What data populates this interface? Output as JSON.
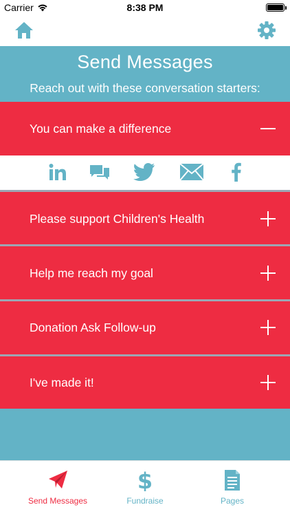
{
  "status_bar": {
    "carrier": "Carrier",
    "time": "8:38 PM"
  },
  "nav": {
    "home_icon": "home-icon",
    "settings_icon": "gear-icon"
  },
  "header": {
    "title": "Send Messages",
    "subtitle": "Reach out with these conversation starters:"
  },
  "sections": [
    {
      "label": "You can make a difference",
      "expanded": true
    },
    {
      "label": "Please support Children's Health",
      "expanded": false
    },
    {
      "label": "Help me reach my goal",
      "expanded": false
    },
    {
      "label": "Donation Ask Follow-up",
      "expanded": false
    },
    {
      "label": "I've made it!",
      "expanded": false
    }
  ],
  "share_icons": [
    "linkedin-icon",
    "message-icon",
    "twitter-icon",
    "email-icon",
    "facebook-icon"
  ],
  "tabs": [
    {
      "label": "Send Messages",
      "icon": "paper-plane-icon",
      "active": true
    },
    {
      "label": "Fundraise",
      "icon": "dollar-icon",
      "active": false
    },
    {
      "label": "Pages",
      "icon": "document-icon",
      "active": false
    }
  ],
  "colors": {
    "accent_red": "#ee2c42",
    "teal": "#63b3c6",
    "divider": "#9da6b4",
    "tab_inactive": "#63b3c6"
  }
}
